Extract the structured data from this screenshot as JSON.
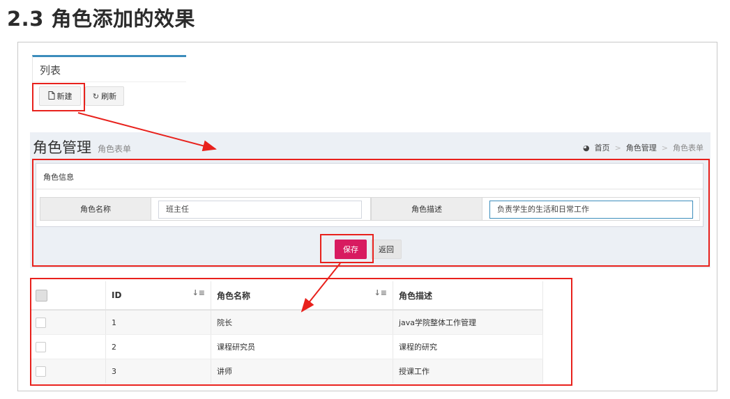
{
  "doc": {
    "heading": "2.3 角色添加的效果"
  },
  "list_panel": {
    "title": "列表",
    "new_button": "新建",
    "refresh_button": "刷新"
  },
  "header": {
    "title": "角色管理",
    "subtitle": "角色表单",
    "breadcrumb": [
      "首页",
      "角色管理",
      "角色表单"
    ]
  },
  "form": {
    "box_title": "角色信息",
    "name_label": "角色名称",
    "name_value": "班主任",
    "desc_label": "角色描述",
    "desc_value": "负责学生的生活和日常工作",
    "save_button": "保存",
    "back_button": "返回"
  },
  "table": {
    "columns": [
      "ID",
      "角色名称",
      "角色描述"
    ],
    "rows": [
      [
        "1",
        "院长",
        "java学院整体工作管理"
      ],
      [
        "2",
        "课程研究员",
        "课程的研究"
      ],
      [
        "3",
        "讲师",
        "授课工作"
      ]
    ]
  },
  "colors": {
    "annotation": "#e8211c",
    "save": "#d81b60",
    "accent": "#3c8dbc"
  }
}
